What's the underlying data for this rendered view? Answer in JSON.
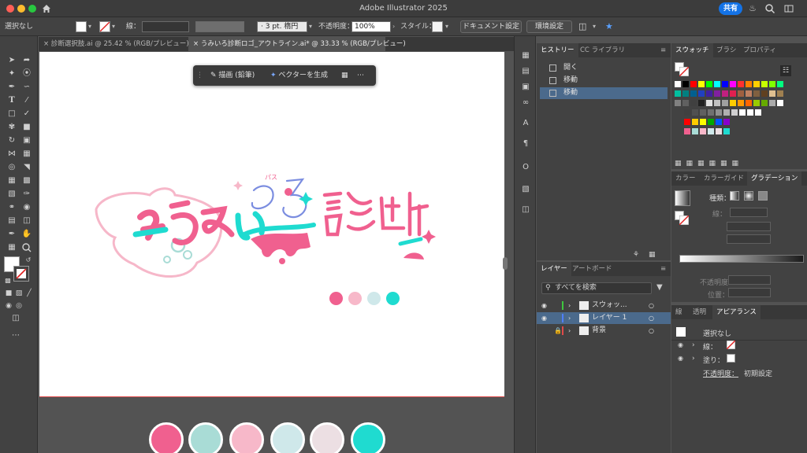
{
  "window": {
    "title": "Adobe Illustrator 2025",
    "share_label": "共有"
  },
  "controlbar": {
    "selection": "選択なし",
    "stroke_label": "線：",
    "brush": "3 pt. 楕円",
    "opacity_label": "不透明度：",
    "opacity_value": "100%",
    "style_label": "スタイル：",
    "doc_settings": "ドキュメント設定",
    "preferences": "環境設定"
  },
  "tabs": [
    {
      "label": "診断選択肢.ai @ 25.42 % (RGB/プレビュー)"
    },
    {
      "label": "うみいろ診断ロゴ_アウトライン.ai* @ 33.33 % (RGB/プレビュー)"
    }
  ],
  "context_bar": {
    "draw_label": "描画 (鉛筆)",
    "vector_label": "ベクターを生成"
  },
  "artwork": {
    "logo_annotation": "パス"
  },
  "colors": {
    "pink": "#f0608f",
    "light_pink": "#f7b8c9",
    "mint": "#a9dcd6",
    "light_mint": "#cfe8ea",
    "pale_pink": "#ecdfe3",
    "cyan": "#1fdbd0"
  },
  "history_panel": {
    "tabs": [
      "ヒストリー",
      "CC ライブラリ"
    ],
    "items": [
      "開く",
      "移動",
      "移動"
    ]
  },
  "layers_panel": {
    "tabs": [
      "レイヤー",
      "アートボード"
    ],
    "search_placeholder": "すべてを検索",
    "rows": [
      "スウォッ...",
      "レイヤー 1",
      "背景"
    ]
  },
  "swatches_panel": {
    "tabs": [
      "スウォッチ",
      "ブラシ",
      "プロパティ"
    ]
  },
  "gradient_panel": {
    "tabs": [
      "カラー",
      "カラーガイド",
      "グラデーション"
    ],
    "type_label": "種類：",
    "stroke_label": "線：",
    "opacity_label": "不透明度：",
    "position_label": "位置："
  },
  "appearance_panel": {
    "tabs": [
      "線",
      "透明",
      "アピアランス"
    ],
    "selection": "選択なし",
    "stroke_label": "線：",
    "fill_label": "塗り：",
    "opacity_label": "不透明度：",
    "opacity_value": "初期設定"
  }
}
